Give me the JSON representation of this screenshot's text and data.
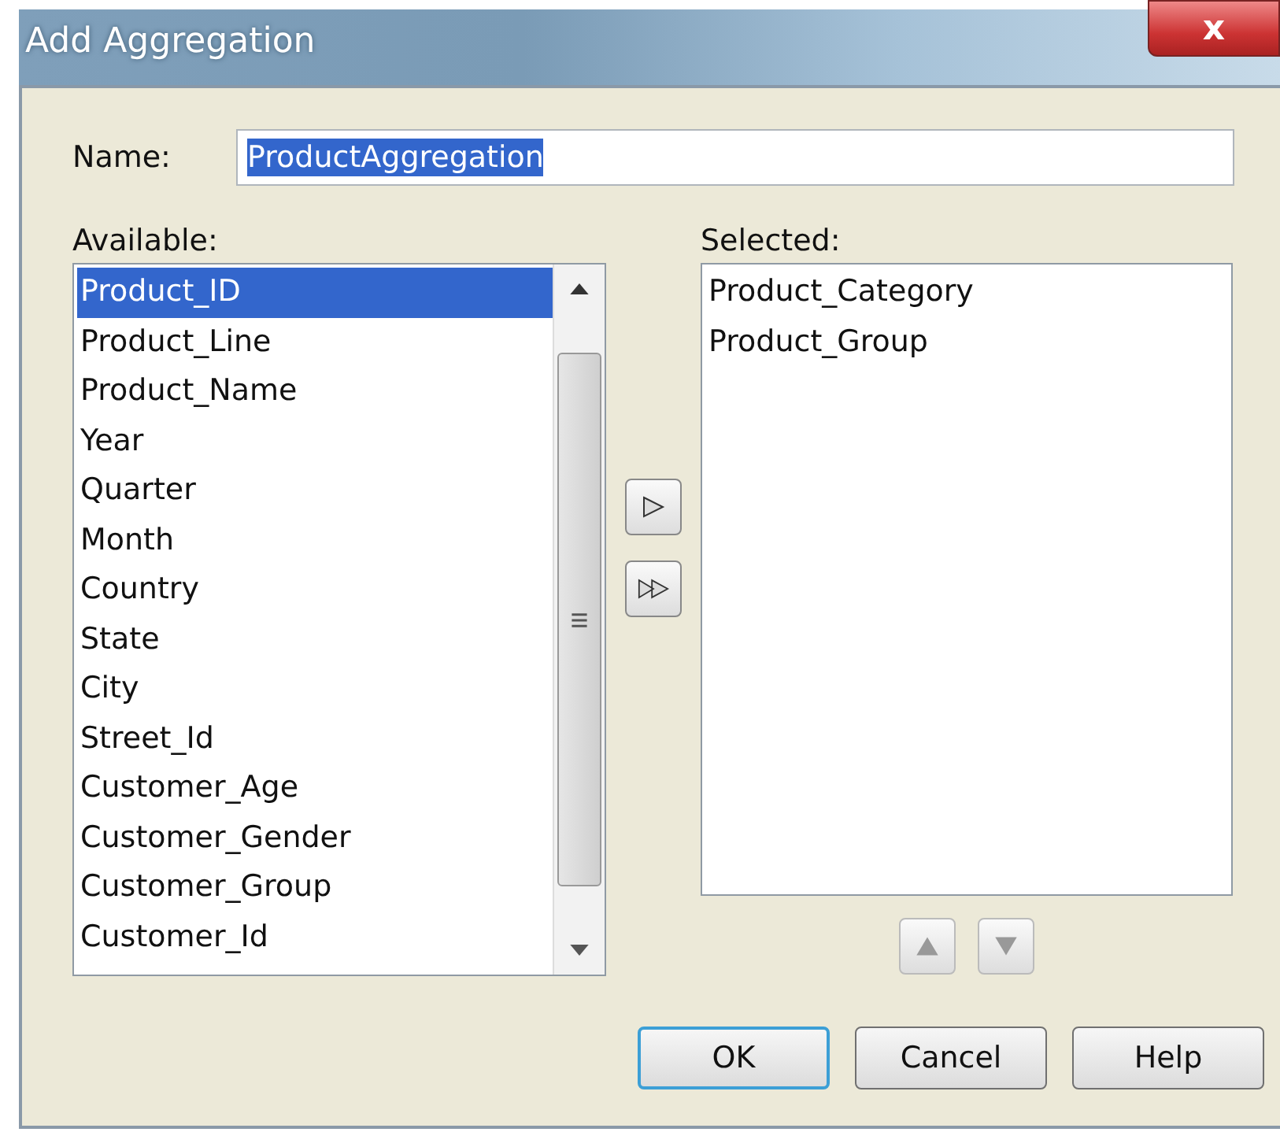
{
  "window": {
    "title": "Add Aggregation",
    "close_label": "x"
  },
  "name_field": {
    "label": "Name:",
    "value": "ProductAggregation"
  },
  "available": {
    "label": "Available:",
    "items": [
      {
        "text": "Product_ID",
        "selected": true
      },
      {
        "text": "Product_Line",
        "selected": false
      },
      {
        "text": "Product_Name",
        "selected": false
      },
      {
        "text": "Year",
        "selected": false
      },
      {
        "text": "Quarter",
        "selected": false
      },
      {
        "text": "Month",
        "selected": false
      },
      {
        "text": "Country",
        "selected": false
      },
      {
        "text": "State",
        "selected": false
      },
      {
        "text": "City",
        "selected": false
      },
      {
        "text": "Street_Id",
        "selected": false
      },
      {
        "text": "Customer_Age",
        "selected": false
      },
      {
        "text": "Customer_Gender",
        "selected": false
      },
      {
        "text": "Customer_Group",
        "selected": false
      },
      {
        "text": "Customer_Id",
        "selected": false
      }
    ]
  },
  "selected_list": {
    "label": "Selected:",
    "items": [
      {
        "text": "Product_Category",
        "selected": false
      },
      {
        "text": "Product_Group",
        "selected": false
      }
    ]
  },
  "buttons": [
    "OK",
    "Cancel",
    "Help"
  ]
}
